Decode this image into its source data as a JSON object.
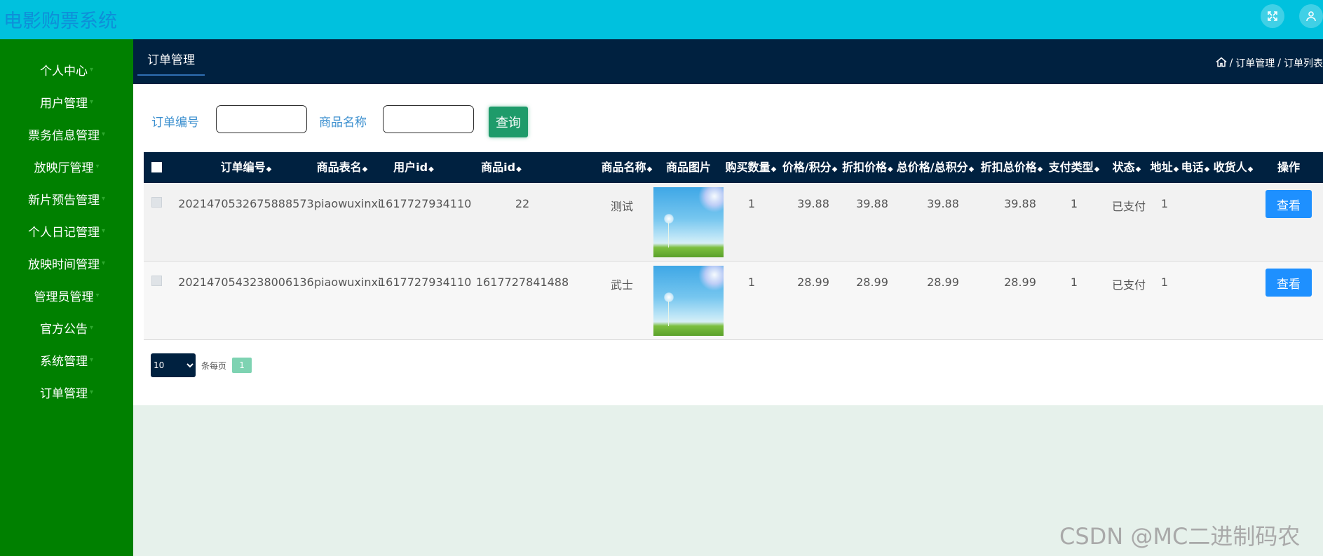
{
  "app": {
    "title": "电影购票系统"
  },
  "header_icons": [
    "fullscreen-icon",
    "user-icon"
  ],
  "sidebar": {
    "items": [
      {
        "label": "个人中心"
      },
      {
        "label": "用户管理"
      },
      {
        "label": "票务信息管理"
      },
      {
        "label": "放映厅管理"
      },
      {
        "label": "新片预告管理"
      },
      {
        "label": "个人日记管理"
      },
      {
        "label": "放映时间管理"
      },
      {
        "label": "管理员管理"
      },
      {
        "label": "官方公告"
      },
      {
        "label": "系统管理"
      },
      {
        "label": "订单管理"
      }
    ]
  },
  "tab": {
    "label": "订单管理"
  },
  "breadcrumb": {
    "items": [
      "订单管理",
      "订单列表"
    ]
  },
  "search": {
    "order_no_label": "订单编号",
    "order_no_value": "",
    "product_name_label": "商品名称",
    "product_name_value": "",
    "button": "查询"
  },
  "table": {
    "columns": [
      "订单编号",
      "商品表名",
      "用户id",
      "商品id",
      "商品名称",
      "商品图片",
      "购买数量",
      "价格/积分",
      "折扣价格",
      "总价格/总积分",
      "折扣总价格",
      "支付类型",
      "状态",
      "地址",
      "电话",
      "收货人",
      "操作"
    ],
    "rows": [
      {
        "order_no": "2021470532675888573",
        "table_name": "piaowuxinxi",
        "user_id": "1617727934110",
        "goods_id": "22",
        "goods_name": "测试",
        "qty": "1",
        "price": "39.88",
        "discount_price": "39.88",
        "total": "39.88",
        "discount_total": "39.88",
        "pay_type": "1",
        "status": "已支付",
        "address": "1",
        "phone": "",
        "receiver": "",
        "action": "查看"
      },
      {
        "order_no": "2021470543238006136",
        "table_name": "piaowuxinxi",
        "user_id": "1617727934110",
        "goods_id": "1617727841488",
        "goods_name": "武士",
        "qty": "1",
        "price": "28.99",
        "discount_price": "28.99",
        "total": "28.99",
        "discount_total": "28.99",
        "pay_type": "1",
        "status": "已支付",
        "address": "1",
        "phone": "",
        "receiver": "",
        "action": "查看"
      }
    ]
  },
  "pagination": {
    "page_size": "10",
    "per_page_text": "条每页",
    "current_page": "1"
  },
  "watermark": "CSDN @MC二进制码农",
  "colors": {
    "topbar": "#00c1de",
    "sidebar": "#008000",
    "dark_navy": "#002140",
    "search_button": "#1e9b6a",
    "view_button": "#1e90ff"
  }
}
